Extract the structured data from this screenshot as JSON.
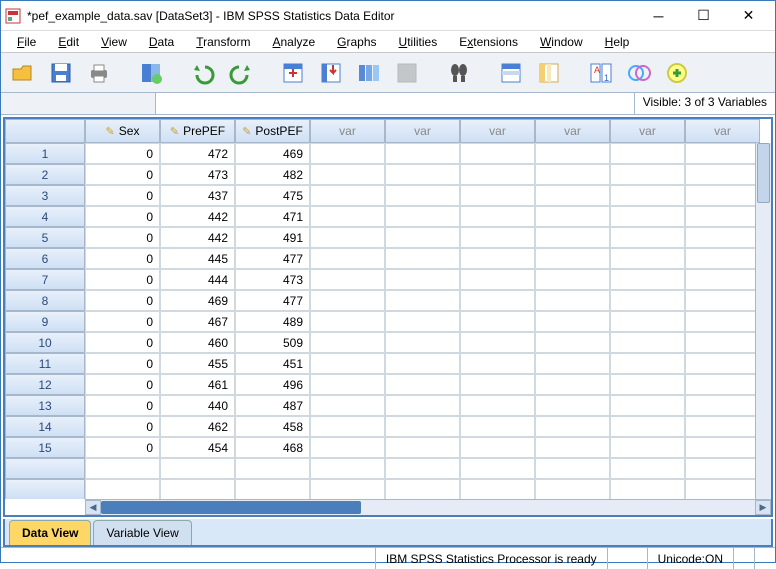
{
  "window": {
    "title": "*pef_example_data.sav [DataSet3] - IBM SPSS Statistics Data Editor"
  },
  "menu": {
    "file": "File",
    "edit": "Edit",
    "view": "View",
    "data": "Data",
    "transform": "Transform",
    "analyze": "Analyze",
    "graphs": "Graphs",
    "utilities": "Utilities",
    "extensions": "Extensions",
    "window": "Window",
    "help": "Help"
  },
  "info": {
    "visible": "Visible: 3 of 3 Variables"
  },
  "columns": {
    "c1": "Sex",
    "c2": "PrePEF",
    "c3": "PostPEF",
    "v": "var"
  },
  "rows": [
    {
      "n": "1",
      "sex": "0",
      "pre": "472",
      "post": "469"
    },
    {
      "n": "2",
      "sex": "0",
      "pre": "473",
      "post": "482"
    },
    {
      "n": "3",
      "sex": "0",
      "pre": "437",
      "post": "475"
    },
    {
      "n": "4",
      "sex": "0",
      "pre": "442",
      "post": "471"
    },
    {
      "n": "5",
      "sex": "0",
      "pre": "442",
      "post": "491"
    },
    {
      "n": "6",
      "sex": "0",
      "pre": "445",
      "post": "477"
    },
    {
      "n": "7",
      "sex": "0",
      "pre": "444",
      "post": "473"
    },
    {
      "n": "8",
      "sex": "0",
      "pre": "469",
      "post": "477"
    },
    {
      "n": "9",
      "sex": "0",
      "pre": "467",
      "post": "489"
    },
    {
      "n": "10",
      "sex": "0",
      "pre": "460",
      "post": "509"
    },
    {
      "n": "11",
      "sex": "0",
      "pre": "455",
      "post": "451"
    },
    {
      "n": "12",
      "sex": "0",
      "pre": "461",
      "post": "496"
    },
    {
      "n": "13",
      "sex": "0",
      "pre": "440",
      "post": "487"
    },
    {
      "n": "14",
      "sex": "0",
      "pre": "462",
      "post": "458"
    },
    {
      "n": "15",
      "sex": "0",
      "pre": "454",
      "post": "468"
    }
  ],
  "tabs": {
    "data": "Data View",
    "variable": "Variable View"
  },
  "status": {
    "processor": "IBM SPSS Statistics Processor is ready",
    "unicode": "Unicode:ON"
  }
}
